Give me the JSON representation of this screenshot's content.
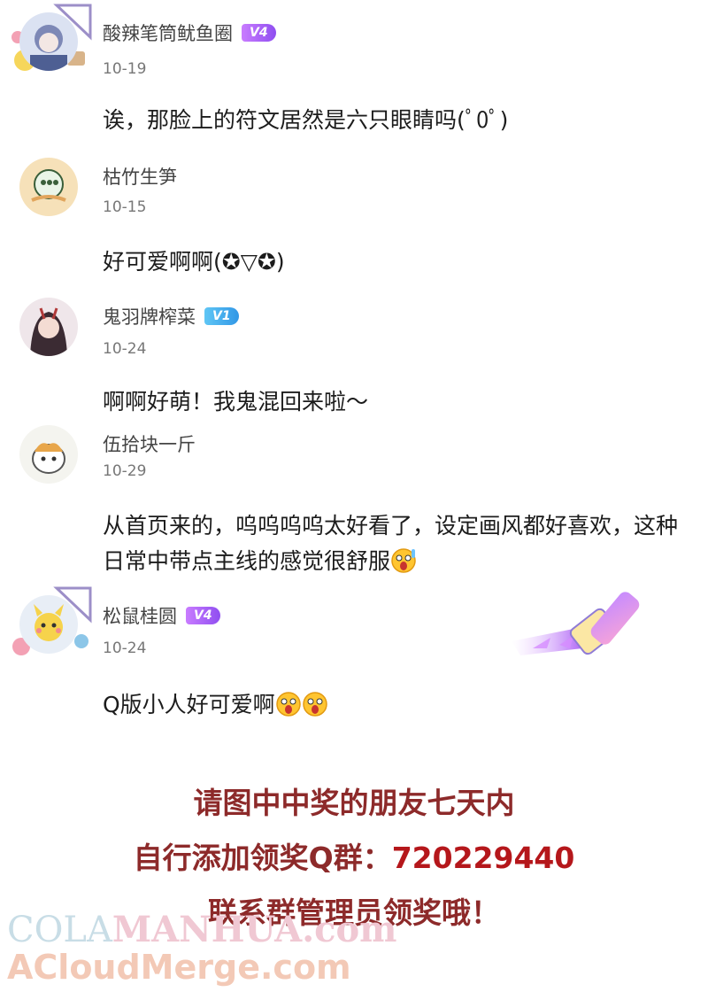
{
  "comments": [
    {
      "username": "酸辣笔筒鱿鱼圈",
      "badge": "V4",
      "date": "10-19",
      "text": "诶，那脸上的符文居然是六只眼睛吗(ﾟ0ﾟ)"
    },
    {
      "username": "枯竹生笋",
      "badge": "",
      "date": "10-15",
      "text": "好可爱啊啊(✪▽✪)"
    },
    {
      "username": "鬼羽牌榨菜",
      "badge": "V1",
      "date": "10-24",
      "text": "啊啊好萌！我鬼混回来啦～"
    },
    {
      "username": "伍拾块一斤",
      "badge": "",
      "date": "10-29",
      "text": "从首页来的，呜呜呜呜太好看了，设定画风都好喜欢，这种日常中带点主线的感觉很舒服"
    },
    {
      "username": "松鼠桂圆",
      "badge": "V4",
      "date": "10-24",
      "text": "Q版小人好可爱啊"
    }
  ],
  "notice": {
    "line1": "请图中中奖的朋友七天内",
    "line2_prefix": "自行添加领奖Q群：",
    "line2_number": "720229440",
    "line3": "联系群管理员领奖哦！"
  },
  "watermark": {
    "part1": "COLA",
    "part2": "MANHUA.com",
    "line2": "ACloudMerge.com"
  },
  "colors": {
    "notice": "#8d2a2a",
    "badge_v4": "#a55cf5",
    "badge_v1": "#3fa9ee"
  },
  "icons": {
    "emoji": "shocked-face-emoji"
  }
}
